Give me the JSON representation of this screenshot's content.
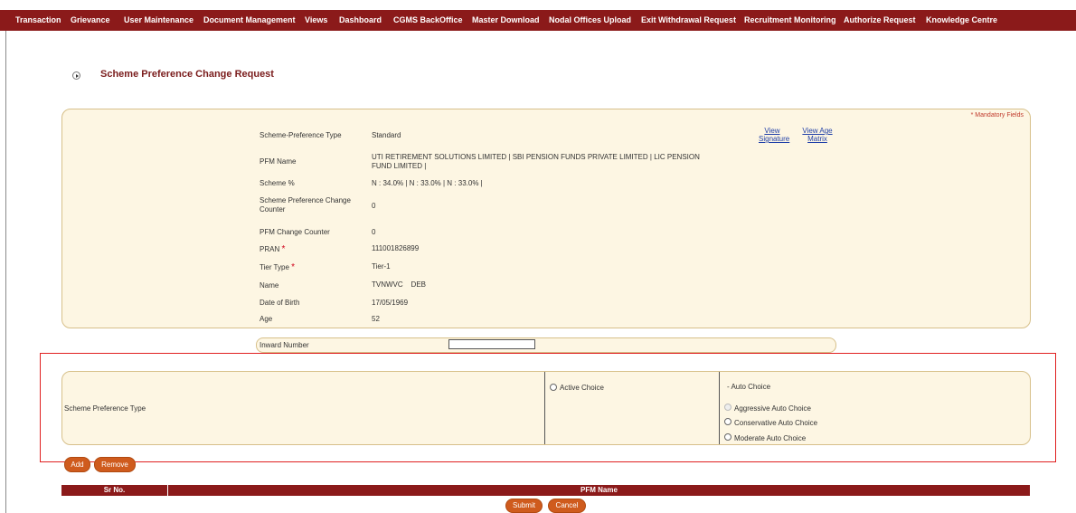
{
  "nav": [
    "Transaction",
    "Grievance",
    "User Maintenance",
    "Document Management",
    "Views",
    "Dashboard",
    "CGMS BackOffice",
    "Master Download",
    "Nodal Offices Upload",
    "Exit Withdrawal Request",
    "Recruitment Monitoring",
    "Authorize Request",
    "Knowledge Centre"
  ],
  "page_title": "Scheme Preference Change Request",
  "mandatory_note": "* Mandatory Fields",
  "links": {
    "view_signature": "View Signature",
    "view_age_matrix": "View Age Matrix"
  },
  "fields": [
    {
      "label": "Scheme-Preference Type",
      "value": "Standard"
    },
    {
      "label": "PFM Name",
      "value": "UTI RETIREMENT SOLUTIONS LIMITED |  SBI PENSION FUNDS PRIVATE LIMITED  |  LIC PENSION FUND LIMITED  |"
    },
    {
      "label": "Scheme %",
      "value": "N : 34.0%  |  N : 33.0%  |  N : 33.0%  |"
    },
    {
      "label": "Scheme Preference Change Counter",
      "value": "0"
    },
    {
      "label": "PFM Change Counter",
      "value": "0"
    },
    {
      "label": "PRAN",
      "value": "111001826899"
    },
    {
      "label": "Tier Type",
      "value": "Tier-1"
    },
    {
      "label": "Name",
      "value": "TVNWVC    DEB"
    },
    {
      "label": "Date of Birth",
      "value": "17/05/1969"
    },
    {
      "label": "Age",
      "value": "52"
    }
  ],
  "inward": {
    "label": "Inward Number",
    "value": ""
  },
  "scheme_pref": {
    "label": "Scheme Preference Type",
    "active": "Active Choice",
    "auto": "- Auto Choice",
    "aggressive": "Aggressive Auto Choice",
    "conservative": "Conservative Auto Choice",
    "moderate": "Moderate Auto Choice"
  },
  "buttons": {
    "add": "Add",
    "remove": "Remove",
    "submit": "Submit",
    "cancel": "Cancel"
  },
  "table": {
    "headers": [
      "Sr No.",
      "PFM Name"
    ]
  },
  "colors": {
    "nav": "#8b1a1a",
    "button": "#cf5b1d",
    "panel": "#fdf6e3",
    "highlight": "#e02020"
  }
}
